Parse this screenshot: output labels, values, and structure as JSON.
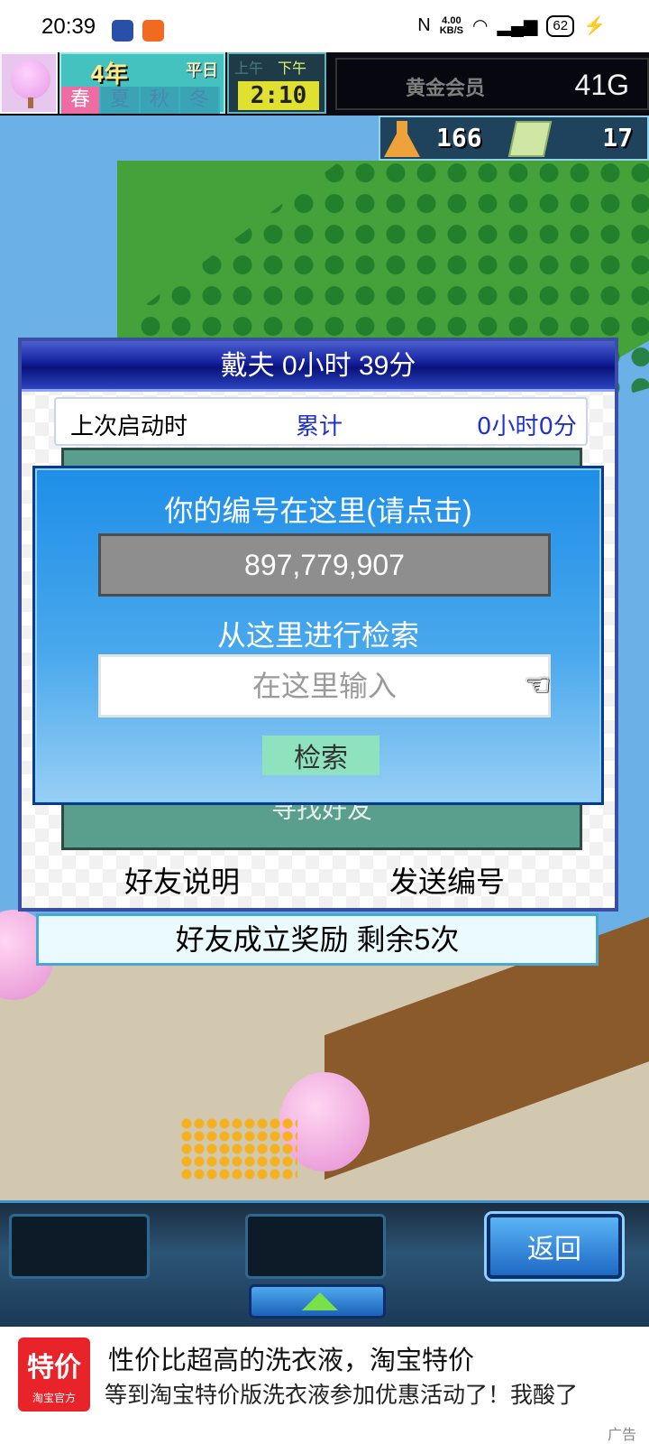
{
  "status_bar": {
    "time": "20:39",
    "net_speed_value": "4.00",
    "net_speed_unit": "KB/S",
    "battery": "62"
  },
  "hud": {
    "year_num": "4",
    "year_unit": "年",
    "weekday": "平日",
    "seasons": [
      "春",
      "夏",
      "秋",
      "冬"
    ],
    "active_season": "春",
    "am": "上午",
    "pm": "下午",
    "clock": "2:10",
    "membership": "黄金会员",
    "gold": "41G",
    "research_points": "166",
    "cash_items": "17"
  },
  "dialog": {
    "title": "戴夫  0小时 39分",
    "stats_label": "上次启动时",
    "stats_accumulated": "累计",
    "stats_value": "0小时0分",
    "find_friend": "寻找好友",
    "help_button": "好友说明",
    "send_button": "发送编号"
  },
  "popup": {
    "heading": "你的编号在这里(请点击)",
    "player_id": "897,779,907",
    "search_heading": "从这里进行检索",
    "search_placeholder": "在这里输入",
    "search_button": "检索"
  },
  "reward_banner": "好友成立奖励  剩余5次",
  "toolbar": {
    "back_button": "返回"
  },
  "ad": {
    "logo_big": "特价",
    "logo_small": "淘宝官方",
    "title": "性价比超高的洗衣液，淘宝特价",
    "description": "等到淘宝特价版洗衣液参加优惠活动了！我酸了",
    "tag": "广告"
  },
  "colors": {
    "dialog_title_bg": "#14209c",
    "popup_bg": "#1e8ee8",
    "teal_area": "#5a9e8e",
    "search_button": "#8ee2bd",
    "accent_blue": "#2032c8"
  }
}
